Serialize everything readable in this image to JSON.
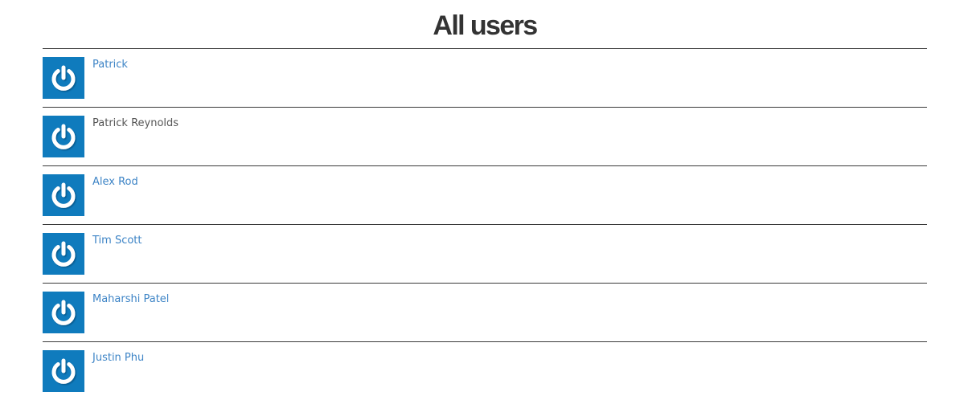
{
  "header": {
    "title": "All users"
  },
  "users": [
    {
      "name": "Patrick",
      "linked": true,
      "avatar_icon": "power-icon"
    },
    {
      "name": "Patrick Reynolds",
      "linked": false,
      "avatar_icon": "power-icon"
    },
    {
      "name": "Alex Rod",
      "linked": true,
      "avatar_icon": "power-icon"
    },
    {
      "name": "Tim Scott",
      "linked": true,
      "avatar_icon": "power-icon"
    },
    {
      "name": "Maharshi Patel",
      "linked": true,
      "avatar_icon": "power-icon"
    },
    {
      "name": "Justin Phu",
      "linked": true,
      "avatar_icon": "power-icon"
    }
  ],
  "colors": {
    "avatar_background": "#0f7bbd",
    "link": "#3d84c6",
    "plain_text": "#555555",
    "title": "#333333",
    "divider": "#3a3a3a"
  }
}
